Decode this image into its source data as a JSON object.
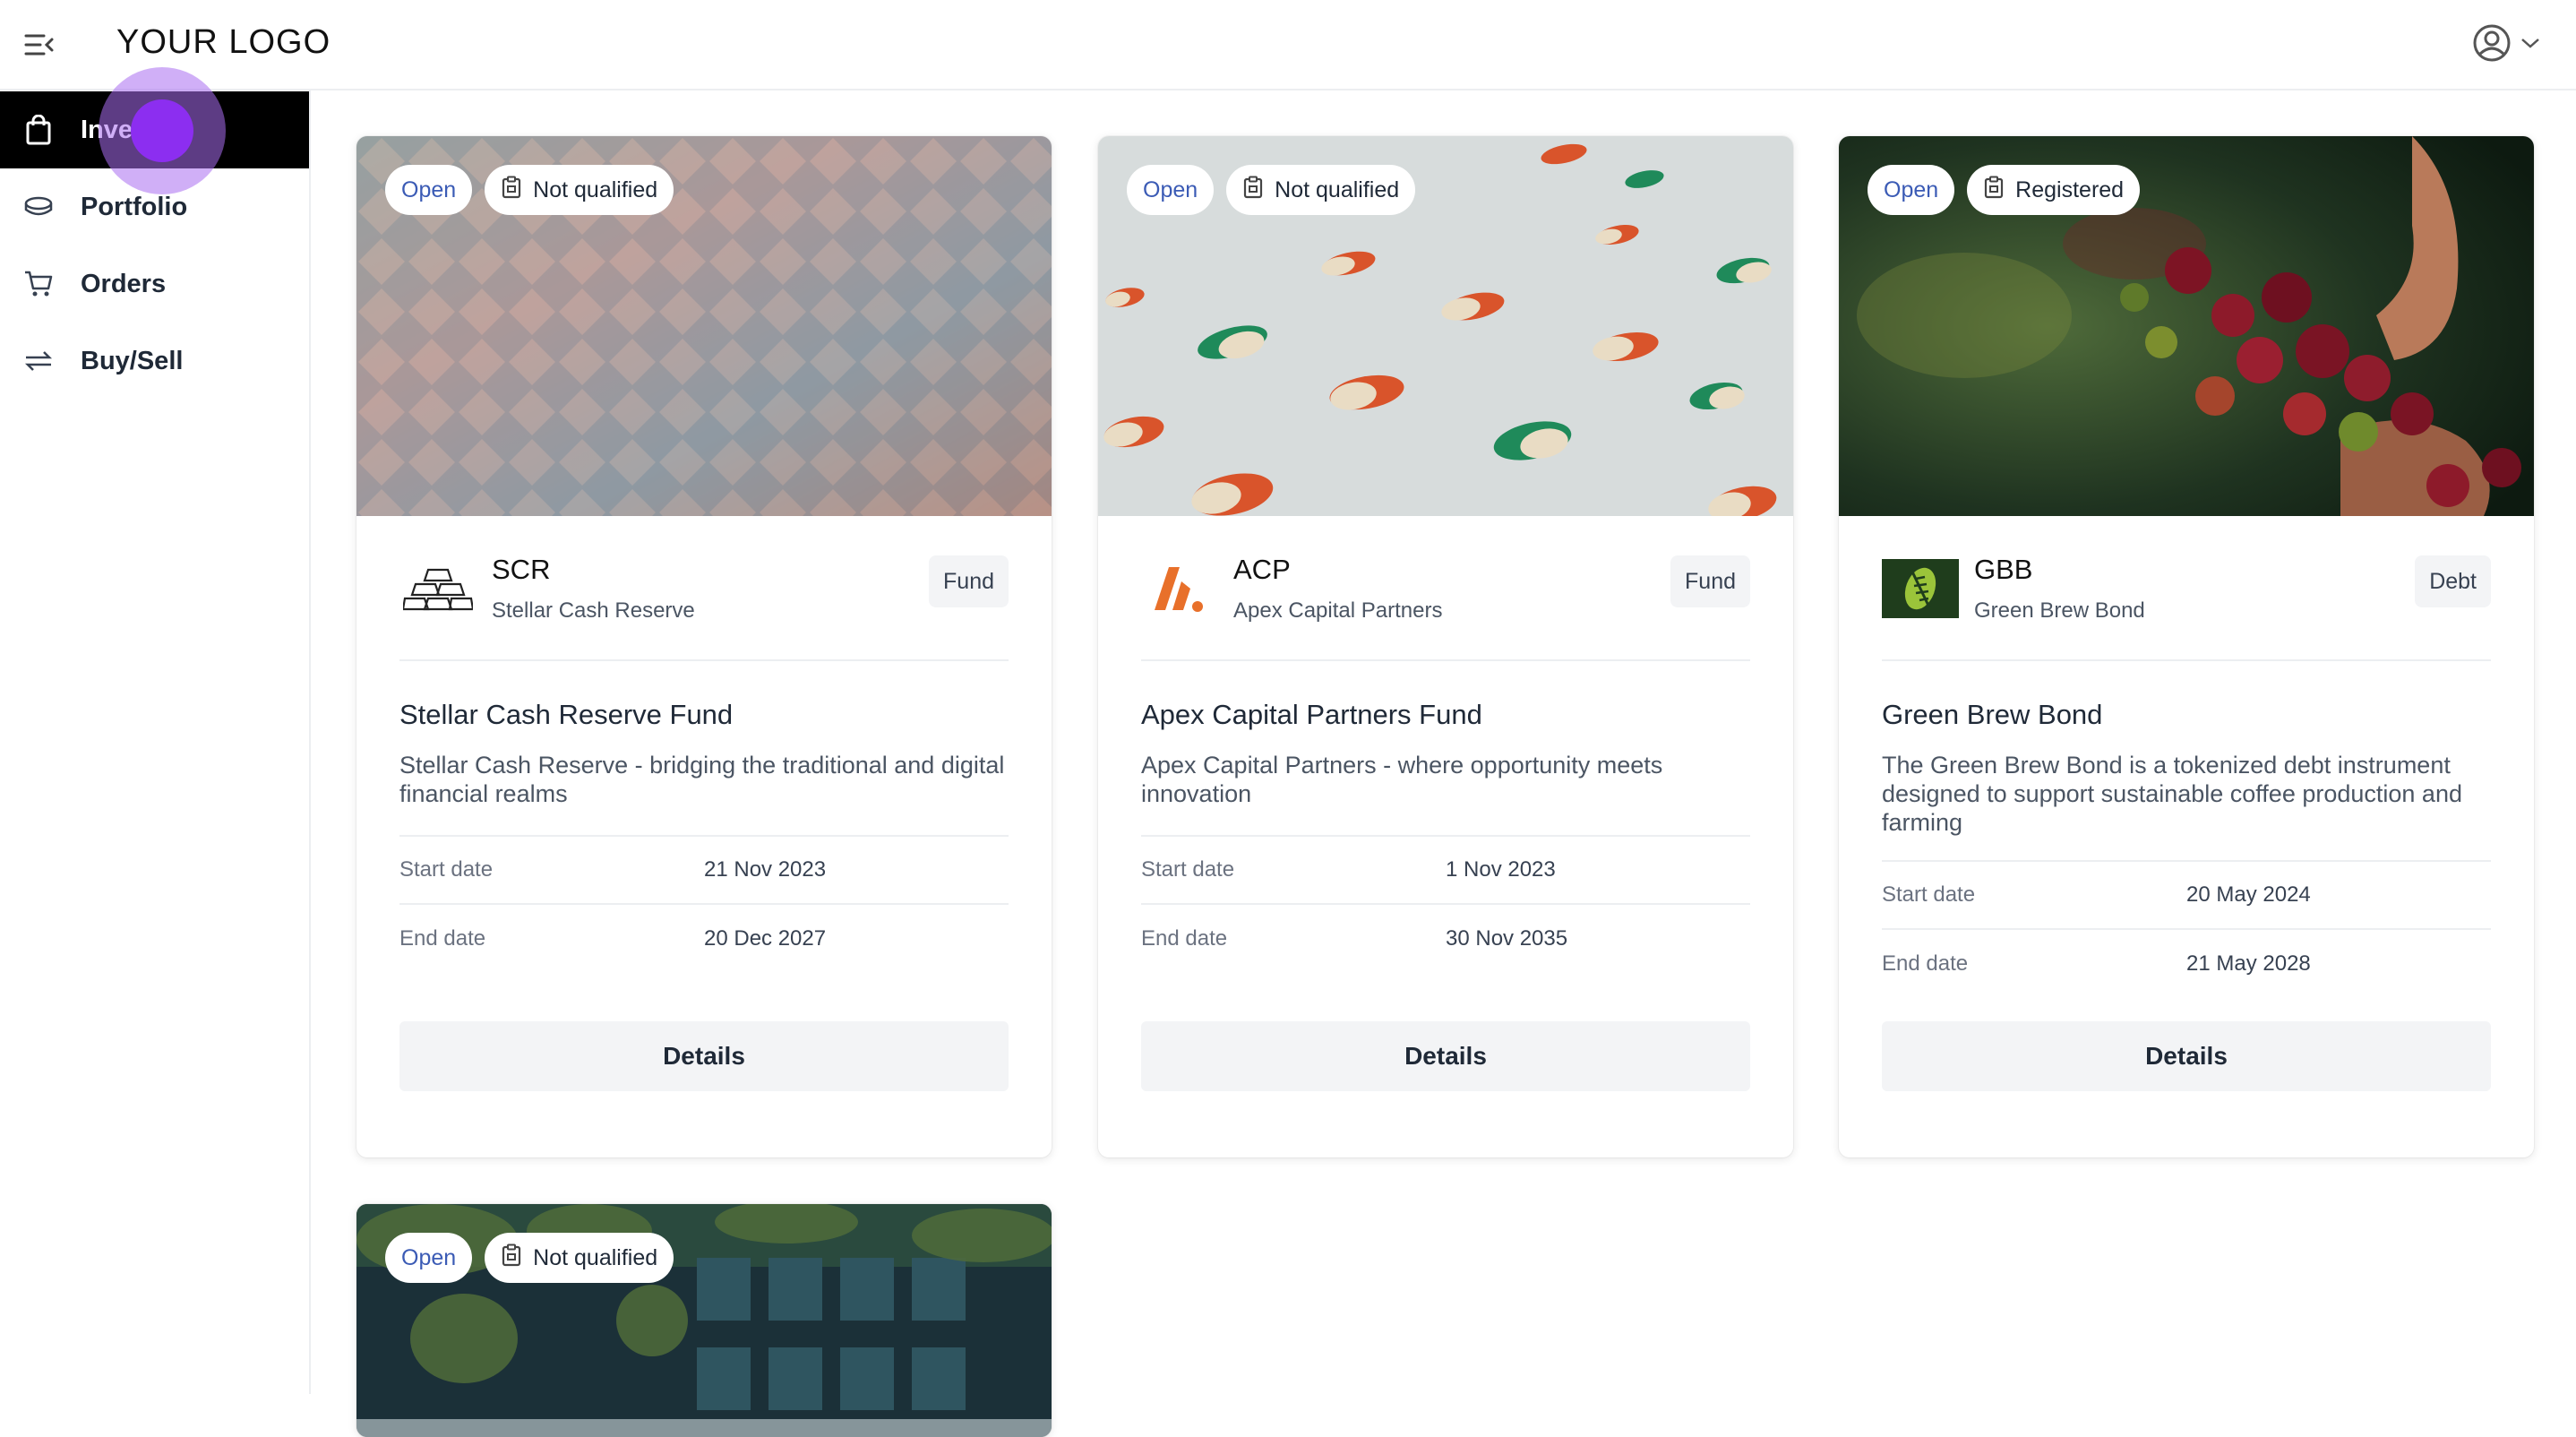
{
  "header": {
    "logo": "YOUR LOGO"
  },
  "sidebar": {
    "items": [
      {
        "label": "Invest",
        "icon": "bag-icon",
        "active": true
      },
      {
        "label": "Portfolio",
        "icon": "coins-icon"
      },
      {
        "label": "Orders",
        "icon": "cart-icon"
      },
      {
        "label": "Buy/Sell",
        "icon": "swap-icon"
      }
    ]
  },
  "cards": [
    {
      "status": "Open",
      "qualification": "Not qualified",
      "code": "SCR",
      "issuer": "Stellar Cash Reserve",
      "type": "Fund",
      "title": "Stellar Cash Reserve Fund",
      "description": "Stellar Cash Reserve - bridging the traditional and digital financial realms",
      "start_label": "Start date",
      "start_date": "21 Nov 2023",
      "end_label": "End date",
      "end_date": "20 Dec 2027",
      "button": "Details"
    },
    {
      "status": "Open",
      "qualification": "Not qualified",
      "code": "ACP",
      "issuer": "Apex Capital Partners",
      "type": "Fund",
      "title": "Apex Capital Partners Fund",
      "description": "Apex Capital Partners - where opportunity meets innovation",
      "start_label": "Start date",
      "start_date": "1 Nov 2023",
      "end_label": "End date",
      "end_date": "30 Nov 2035",
      "button": "Details"
    },
    {
      "status": "Open",
      "qualification": "Registered",
      "code": "GBB",
      "issuer": "Green Brew Bond",
      "type": "Debt",
      "title": "Green Brew Bond",
      "description": "The Green Brew Bond is a tokenized debt instrument designed to support sustainable coffee production and farming",
      "start_label": "Start date",
      "start_date": "20 May 2024",
      "end_label": "End date",
      "end_date": "21 May 2028",
      "button": "Details"
    },
    {
      "status": "Open",
      "qualification": "Not qualified"
    }
  ],
  "colors": {
    "active_nav_bg": "#000000",
    "open_badge_text": "#3b5bb5",
    "accent_orange": "#e8702a",
    "gbb_green": "#1f3d1c"
  }
}
